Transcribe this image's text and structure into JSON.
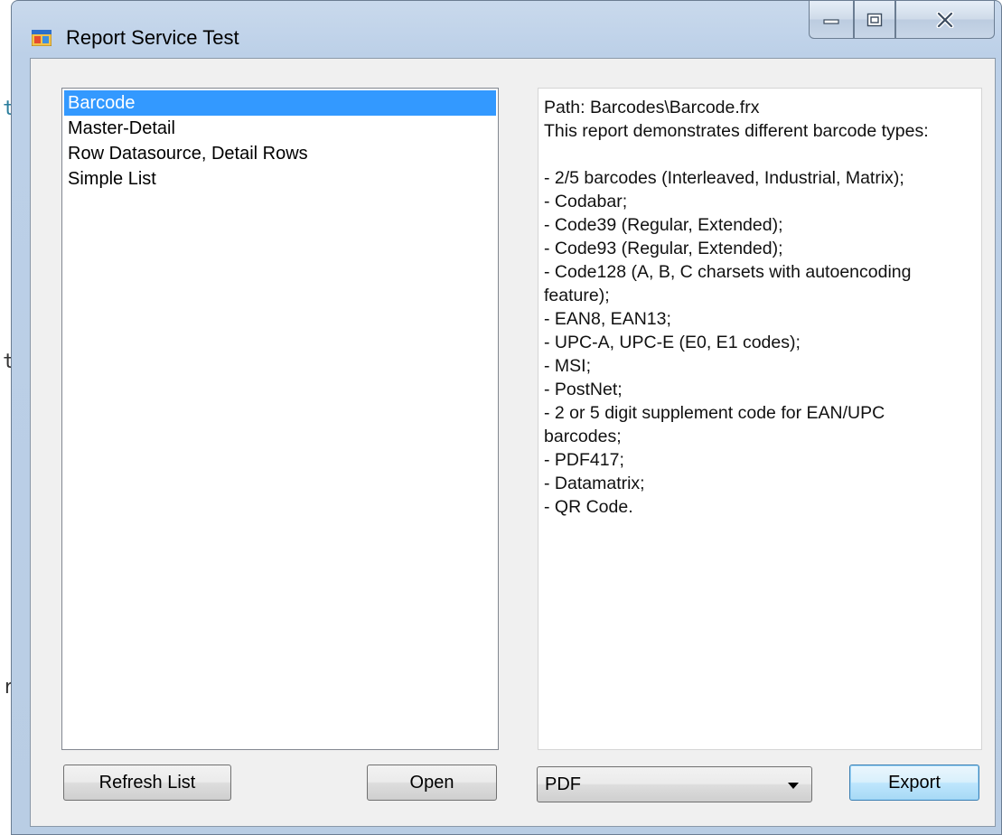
{
  "background": {
    "chars": [
      "t",
      "t",
      "r"
    ]
  },
  "window": {
    "title": "Report Service Test",
    "icons": {
      "app": "app-window-icon",
      "minimize": "minimize-icon",
      "maximize": "maximize-icon",
      "close": "close-icon"
    }
  },
  "report_list": {
    "items": [
      {
        "label": "Barcode",
        "selected": true
      },
      {
        "label": "Master-Detail",
        "selected": false
      },
      {
        "label": "Row Datasource, Detail Rows",
        "selected": false
      },
      {
        "label": "Simple List",
        "selected": false
      }
    ]
  },
  "details": {
    "lines": [
      "Path: Barcodes\\Barcode.frx",
      "This report demonstrates different barcode types:",
      "",
      "- 2/5 barcodes (Interleaved, Industrial, Matrix);",
      "- Codabar;",
      "- Code39 (Regular, Extended);",
      "- Code93 (Regular, Extended);",
      "- Code128 (A, B, C charsets with autoencoding",
      "feature);",
      "- EAN8, EAN13;",
      "- UPC-A, UPC-E (E0, E1 codes);",
      "- MSI;",
      "- PostNet;",
      "- 2 or 5 digit supplement code for EAN/UPC",
      "barcodes;",
      "- PDF417;",
      "- Datamatrix;",
      "- QR Code."
    ]
  },
  "buttons": {
    "refresh": "Refresh List",
    "open": "Open",
    "export": "Export"
  },
  "export_format": {
    "selected": "PDF"
  },
  "colors": {
    "selection": "#3399ff",
    "frame": "#bcd0e8"
  }
}
